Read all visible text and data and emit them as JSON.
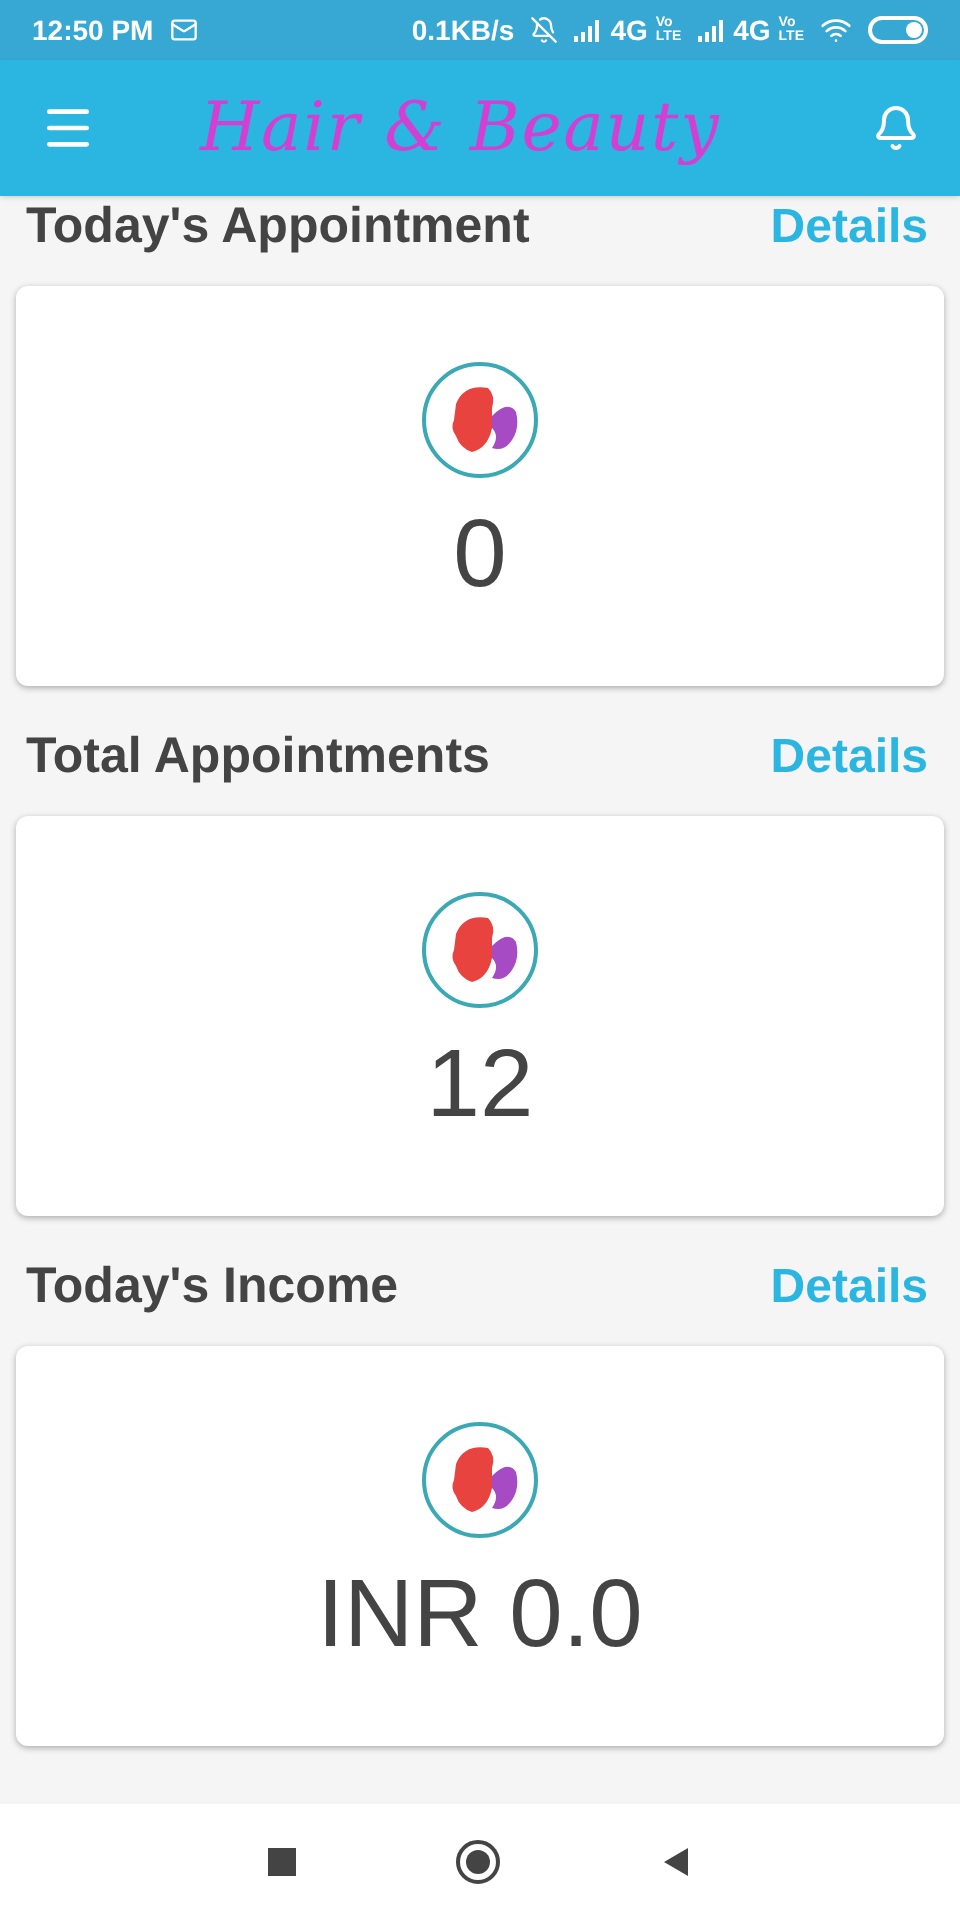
{
  "status_bar": {
    "time": "12:50 PM",
    "speed": "0.1KB/s",
    "networks": [
      {
        "type": "4G",
        "volte": [
          "Vo",
          "LTE"
        ]
      },
      {
        "type": "4G",
        "volte": [
          "Vo",
          "LTE"
        ]
      }
    ]
  },
  "app_bar": {
    "title": "Hair & Beauty"
  },
  "sections": [
    {
      "title": "Today's Appointment",
      "link": "Details",
      "value": "0"
    },
    {
      "title": "Total Appointments",
      "link": "Details",
      "value": "12"
    },
    {
      "title": "Today's Income",
      "link": "Details",
      "value": "INR 0.0"
    }
  ]
}
